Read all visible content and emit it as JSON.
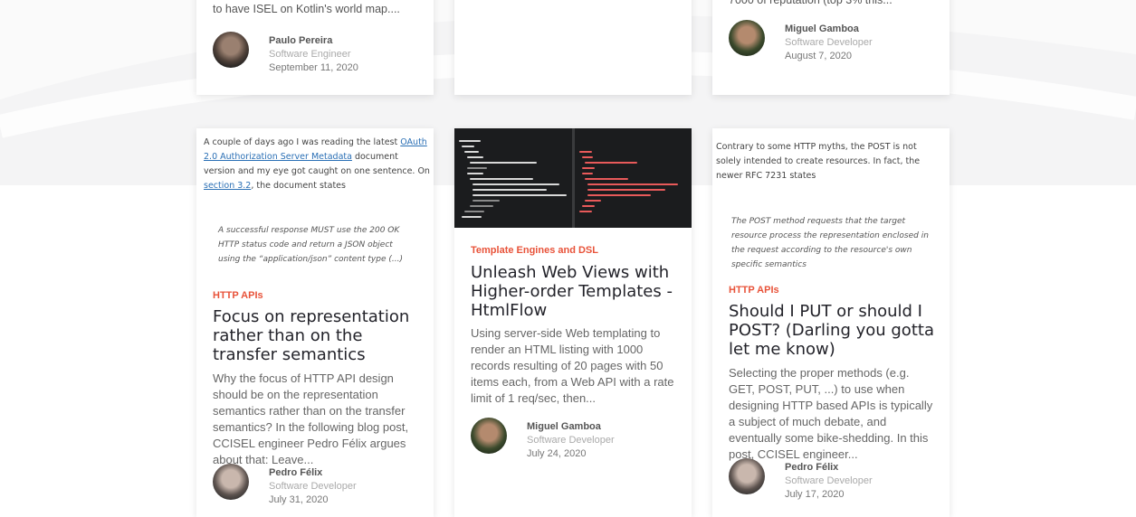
{
  "top_row": {
    "left_card": {
      "excerpt": "Kotlin in university courses. Feels good to have ISEL on Kotlin's world map....",
      "author": {
        "name": "Paulo Pereira",
        "role": "Software Engineer",
        "date": "September 11, 2020"
      }
    },
    "right_card": {
      "excerpt": "7000 of reputation (top 3% this...",
      "author": {
        "name": "Miguel Gamboa",
        "role": "Software Developer",
        "date": "August 7, 2020"
      }
    }
  },
  "posts": [
    {
      "preview": {
        "before_link1": "A couple of days ago I was reading the latest ",
        "link1": "OAuth 2.0 Authorization Server Metadata",
        "middle": " document version and my eye got caught on one sentence. On ",
        "link2": "section 3.2",
        "after": ", the document states",
        "quote": "A successful response MUST use the 200 OK HTTP status code and return a JSON object using the “application/json” content type (...)"
      },
      "category": "HTTP APIs",
      "title": "Focus on representation rather than on the transfer semantics",
      "excerpt": "Why the focus of HTTP API design should be on the representation semantics rather than on the transfer semantics? In the following blog post, CCISEL engineer Pedro Félix argues about that: Leave...",
      "author": {
        "name": "Pedro Félix",
        "role": "Software Developer",
        "date": "July 31, 2020"
      }
    },
    {
      "category": "Template Engines and DSL",
      "title": "Unleash Web Views with Higher-order Templates - HtmlFlow",
      "excerpt": "Using server-side Web templating to render an HTML listing with 1000 records resulting of 20 pages with 50 items each, from a Web API with a rate limit of 1 req/sec, then...",
      "author": {
        "name": "Miguel Gamboa",
        "role": "Software Developer",
        "date": "July 24, 2020"
      }
    },
    {
      "preview": {
        "text": "Contrary to some HTTP myths, the POST is not solely intended to create resources. In fact, the newer RFC 7231 states",
        "quote": "The POST method requests that the target resource process the representation enclosed in the request according to the resource's own specific semantics"
      },
      "category": "HTTP APIs",
      "title": "Should I PUT or should I POST? (Darling you gotta let me know)",
      "excerpt": "Selecting the proper methods (e.g. GET, POST, PUT, ...) to use when designing HTTP based APIs is typically a subject of much debate, and eventually some bike-shedding. In this post, CCISEL engineer...",
      "author": {
        "name": "Pedro Félix",
        "role": "Software Developer",
        "date": "July 17, 2020"
      }
    }
  ]
}
